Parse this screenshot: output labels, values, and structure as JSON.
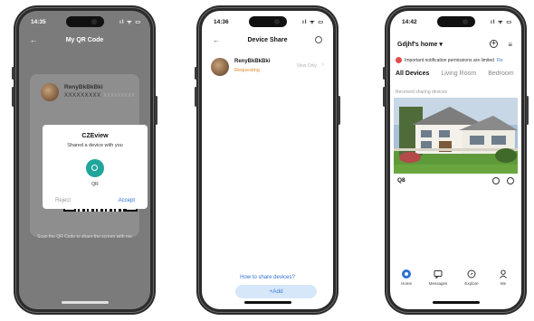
{
  "status_times": {
    "p1": "14:35",
    "p2": "14:36",
    "p3": "14:42"
  },
  "status_icons": {
    "p1": "ıl ᯤ ▭",
    "p2": "ıl ᯤ ▭",
    "p3": "ıl ᯤ ▭"
  },
  "phone1": {
    "title": "My QR Code",
    "user_name": "RenyBkBkBki",
    "user_id": "XXXXXXXXX",
    "user_id_sub": "XXXXXXXXX",
    "hint": "Scan the QR Code to share the screen with me",
    "dialog": {
      "title": "CZEview",
      "subtitle": "Shared a device with you",
      "device_label": "QR",
      "reject": "Reject",
      "accept": "Accept"
    }
  },
  "phone2": {
    "title": "Device Share",
    "share": {
      "name": "RenyBkBkBki",
      "status": "Requesting",
      "action": "View Only"
    },
    "how_to": "How to share devices?",
    "add_button": "+Add"
  },
  "phone3": {
    "home_name": "Gdjhf's home ▾",
    "notice": "Important notification permissions are limited",
    "notice_action": "Fix",
    "tabs": [
      "All Devices",
      "Living Room",
      "Bedroom"
    ],
    "received_label": "Received sharing devices",
    "camera_name": "Q8",
    "bottom_tabs": [
      "Home",
      "Messages",
      "Explore",
      "Me"
    ]
  }
}
